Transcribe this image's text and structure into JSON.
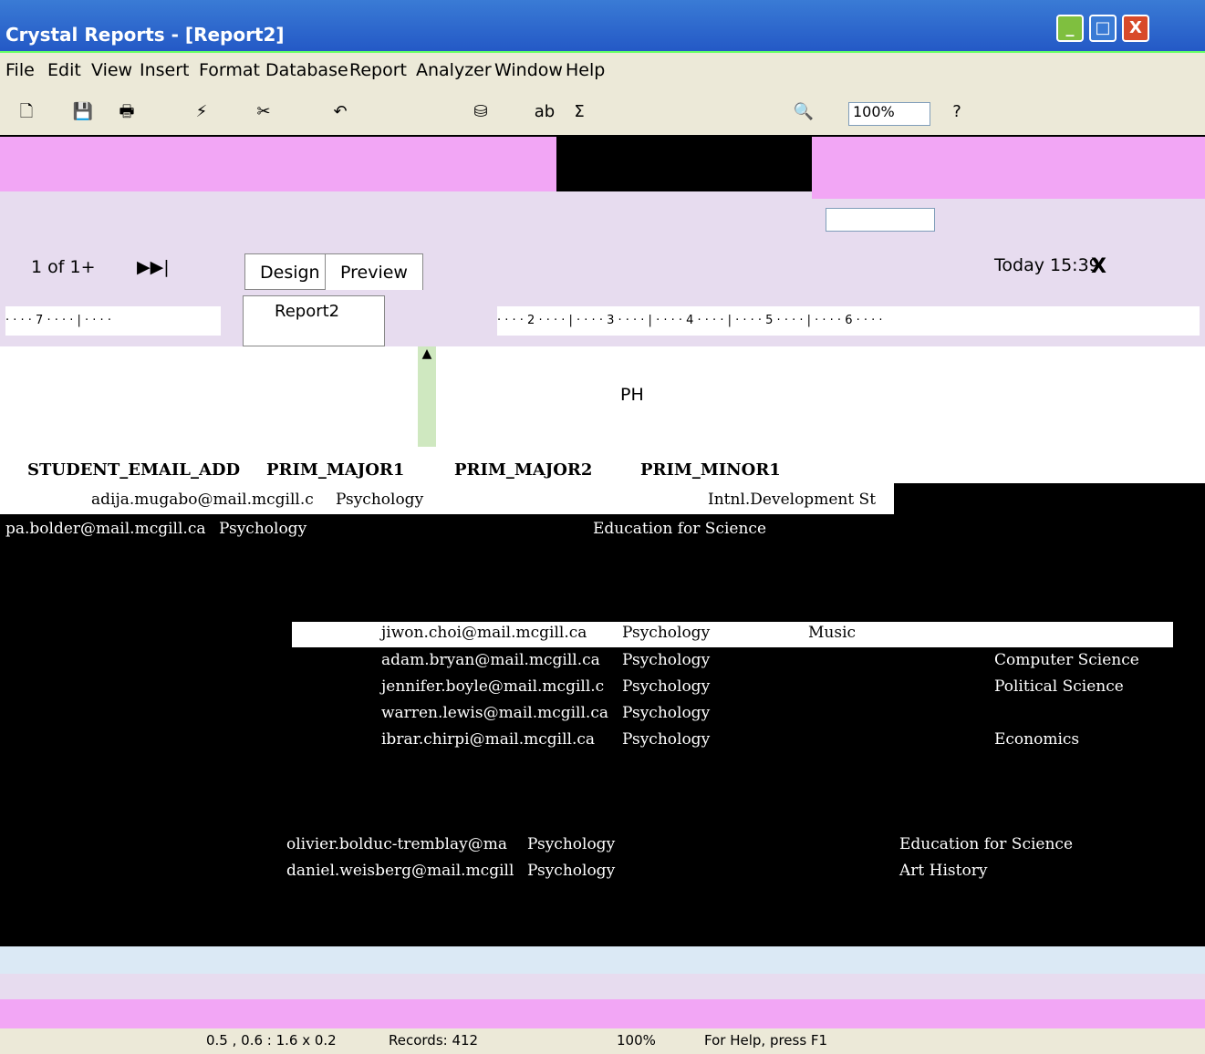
{
  "window": {
    "title": "Crystal Reports - [Report2]",
    "controls": [
      "_",
      "□",
      "X"
    ]
  },
  "menu": {
    "items": [
      "File",
      "Edit",
      "View",
      "Insert",
      "Format",
      "Database",
      "Report",
      "Analyzer",
      "Window",
      "Help"
    ]
  },
  "toolbar": {
    "zoom": "100%",
    "help": "?"
  },
  "nav": {
    "page": "1 of 1+",
    "time": "Today 15:39",
    "close": "X"
  },
  "tabs": {
    "design": "Design",
    "preview": "Preview",
    "tree_root": "Report2"
  },
  "ruler": {
    "left": "· · · · 7 · · · · | · · · ·",
    "right": "· · · · 2 · · · · | · · · · 3 · · · · | · · · · 4 · · · · | · · · · 5 · · · · | · · · · 6 · · · ·"
  },
  "section": {
    "label": "PH"
  },
  "columns": [
    "STUDENT_EMAIL_ADD",
    "PRIM_MAJOR1",
    "PRIM_MAJOR2",
    "PRIM_MINOR1"
  ],
  "rows": [
    {
      "email": "adija.mugabo@mail.mcgill.c",
      "major": "Psychology",
      "minor": "Intnl.Development St"
    },
    {
      "email": "pa.bolder@mail.mcgill.ca",
      "major": "Psychology",
      "minor": "Education for Science"
    },
    {
      "email": "jiwon.choi@mail.mcgill.ca",
      "major": "Psychology",
      "minor": "Music"
    },
    {
      "email": "adam.bryan@mail.mcgill.ca",
      "major": "Psychology",
      "minor": "Computer Science"
    },
    {
      "email": "jennifer.boyle@mail.mcgill.c",
      "major": "Psychology",
      "minor": "Political Science"
    },
    {
      "email": "warren.lewis@mail.mcgill.ca",
      "major": "Psychology",
      "minor": ""
    },
    {
      "email": "ibrar.chirpi@mail.mcgill.ca",
      "major": "Psychology",
      "minor": "Economics"
    },
    {
      "email": "olivier.bolduc-tremblay@ma",
      "major": "Psychology",
      "minor": "Education for Science"
    },
    {
      "email": "daniel.weisberg@mail.mcgill",
      "major": "Psychology",
      "minor": "Art History"
    }
  ],
  "status": {
    "position": "0.5 , 0.6 : 1.6 x 0.2",
    "records": "Records: 412",
    "zoom": "100%",
    "help": "For Help, press F1"
  }
}
